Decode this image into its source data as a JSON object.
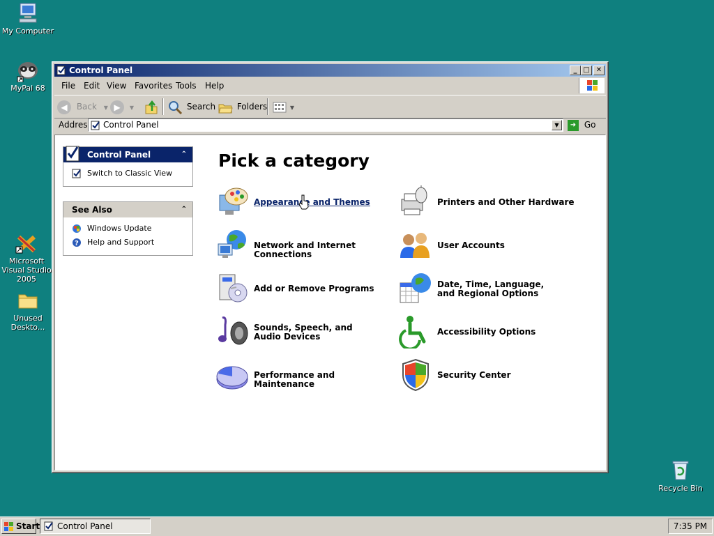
{
  "desktop": {
    "icons": [
      {
        "label": "My Computer",
        "icon": "my-computer-icon"
      },
      {
        "label": "MyPal 68",
        "icon": "mypal-raccoon-icon"
      },
      {
        "label": "Microsoft Visual Studio 2005",
        "icon": "visual-studio-icon"
      },
      {
        "label": "Unused Deskto...",
        "icon": "folder-icon"
      },
      {
        "label": "Recycle Bin",
        "icon": "recycle-bin-icon"
      }
    ]
  },
  "window": {
    "title": "Control Panel",
    "menu": [
      "File",
      "Edit",
      "View",
      "Favorites",
      "Tools",
      "Help"
    ],
    "toolbar": {
      "back": "Back",
      "search": "Search",
      "folders": "Folders"
    },
    "address": {
      "label": "Address",
      "value": "Control Panel",
      "go": "Go"
    }
  },
  "sidebar": {
    "control_panel": {
      "title": "Control Panel",
      "items": [
        "Switch to Classic View"
      ]
    },
    "see_also": {
      "title": "See Also",
      "items": [
        "Windows Update",
        "Help and Support"
      ]
    }
  },
  "main": {
    "heading": "Pick a category",
    "categories": [
      {
        "label": "Appearance and Themes",
        "icon": "appearance-themes-icon",
        "hovered": true
      },
      {
        "label": "Printers and Other Hardware",
        "icon": "printer-icon"
      },
      {
        "label": "Network and Internet Connections",
        "icon": "network-globe-icon"
      },
      {
        "label": "User Accounts",
        "icon": "user-accounts-icon"
      },
      {
        "label": "Add or Remove Programs",
        "icon": "add-remove-programs-icon"
      },
      {
        "label": "Date, Time, Language, and Regional Options",
        "icon": "date-time-globe-icon"
      },
      {
        "label": "Sounds, Speech, and Audio Devices",
        "icon": "speaker-icon"
      },
      {
        "label": "Accessibility Options",
        "icon": "accessibility-icon"
      },
      {
        "label": "Performance and Maintenance",
        "icon": "pie-chart-icon"
      },
      {
        "label": "Security Center",
        "icon": "shield-icon"
      }
    ]
  },
  "taskbar": {
    "start": "Start",
    "task": "Control Panel",
    "clock": "7:35 PM"
  },
  "colors": {
    "desktop": "#0f807f",
    "titlebar": "#0a246a",
    "link": "#0a246a"
  }
}
